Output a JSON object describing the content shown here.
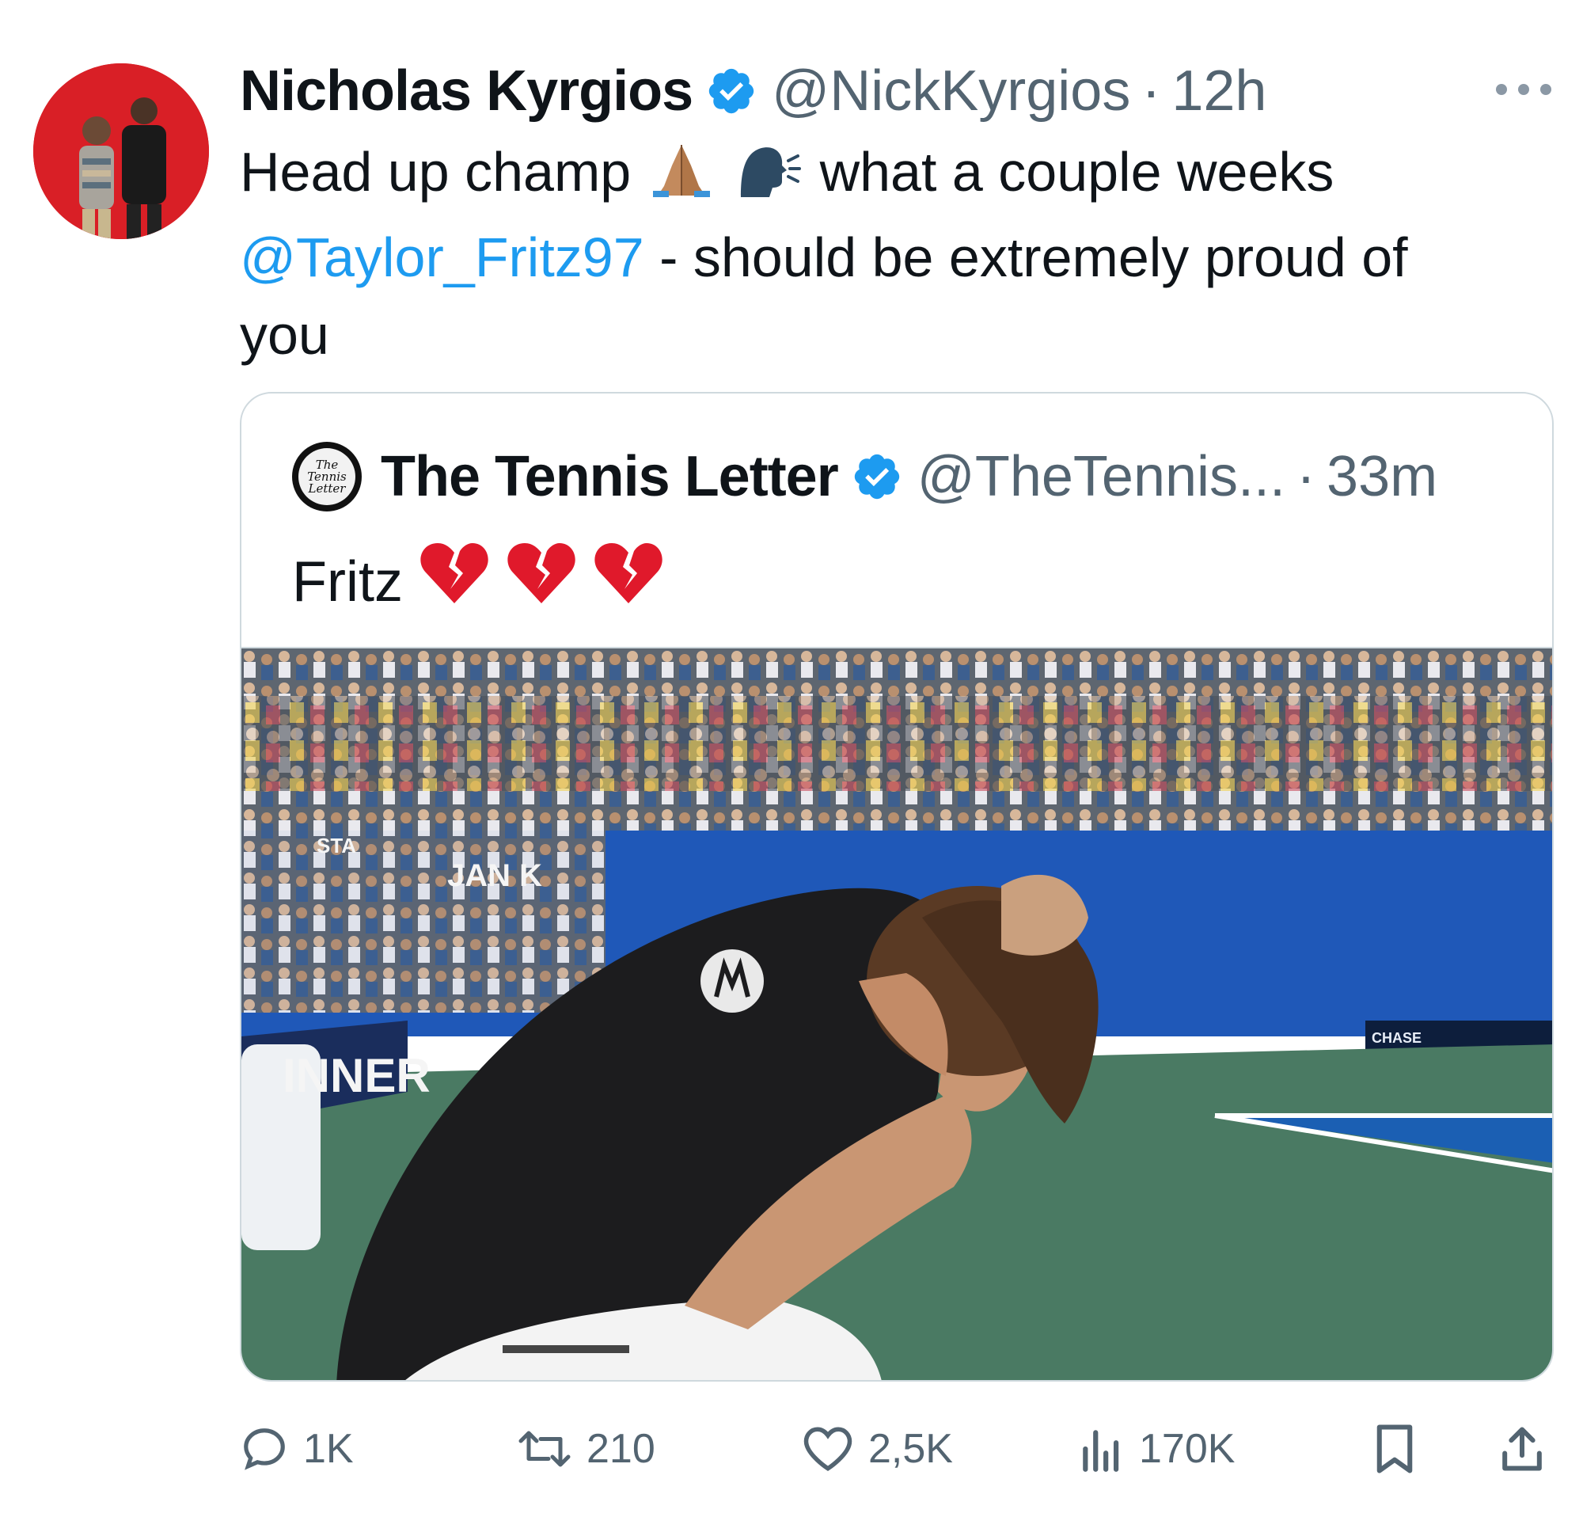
{
  "tweet": {
    "author_name": "Nicholas Kyrgios",
    "handle": "@NickKyrgios",
    "separator": "·",
    "time": "12h",
    "text_part1": "Head up champ",
    "text_part2": "what a couple weeks",
    "mention": "@Taylor_Fritz97",
    "text_part3": " - should be extremely proud of",
    "text_part4": "you"
  },
  "quote": {
    "author_name": "The Tennis Letter",
    "avatar_text": [
      "The",
      "Tennis",
      "Letter"
    ],
    "handle": "@TheTennis...",
    "separator": "·",
    "time": "33m",
    "text": "Fritz",
    "image_texts": {
      "sponsor_left": "STA",
      "banner_mid": "JAN   K",
      "banner_winner": "INNER",
      "sponsor_right": "CHASE"
    }
  },
  "actions": {
    "replies": "1K",
    "reposts": "210",
    "likes": "2,5K",
    "views": "170K"
  },
  "colors": {
    "link": "#1d9bf0",
    "secondary_text": "#536471",
    "avatar_bg": "#d91f26"
  }
}
